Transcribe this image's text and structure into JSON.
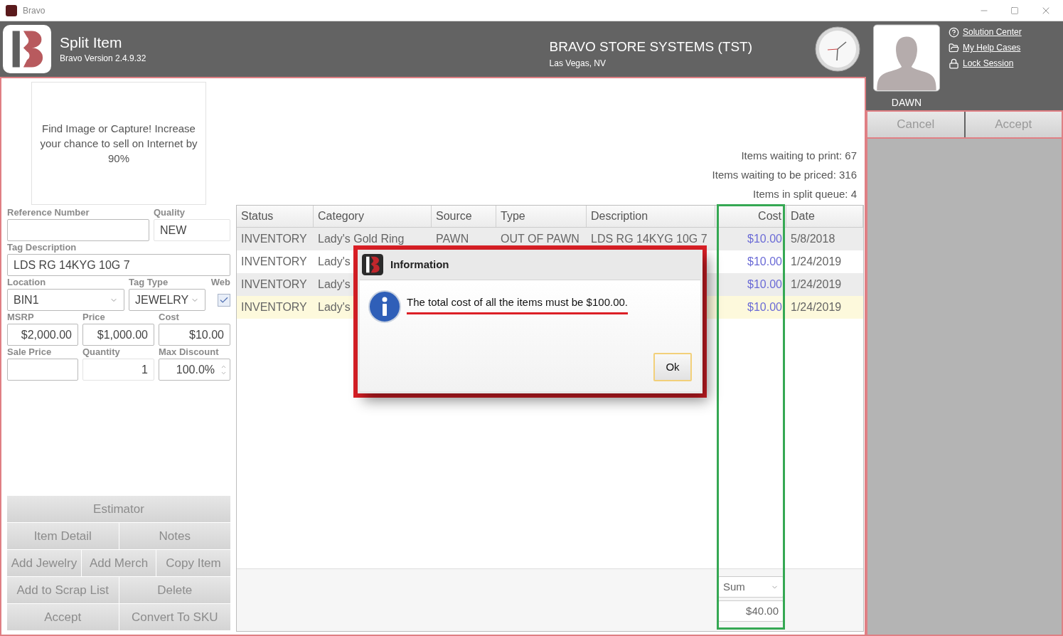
{
  "window": {
    "title": "Bravo"
  },
  "header": {
    "screen_title": "Split Item",
    "version": "Bravo Version 2.4.9.32",
    "store_name": "BRAVO STORE SYSTEMS (TST)",
    "store_location": "Las Vegas, NV",
    "user_name": "DAWN",
    "links": [
      {
        "kind": "help",
        "label": "Solution Center"
      },
      {
        "kind": "folder",
        "label": "My Help Cases"
      },
      {
        "kind": "lock",
        "label": "Lock Session"
      }
    ]
  },
  "actions": [
    "Cancel",
    "Accept"
  ],
  "image_placeholder": "Find Image or Capture! Increase your chance to sell on Internet by 90%",
  "form": [
    [
      {
        "kind": "text",
        "label": "Reference Number"
      },
      {
        "kind": "readonly",
        "label": "Quality",
        "value": "NEW"
      }
    ],
    [
      {
        "kind": "text",
        "label": "Tag Description",
        "value": "LDS RG 14KYG 10G 7"
      }
    ],
    [
      {
        "kind": "select",
        "label": "Location",
        "value": "BIN1"
      },
      {
        "kind": "select",
        "label": "Tag Type",
        "value": "JEWELRY"
      },
      {
        "kind": "checkbox",
        "label": "Web",
        "checked": true
      }
    ],
    [
      {
        "kind": "number",
        "label": "MSRP",
        "value": "$2,000.00"
      },
      {
        "kind": "number",
        "label": "Price",
        "value": "$1,000.00"
      },
      {
        "kind": "number",
        "label": "Cost",
        "value": "$10.00"
      }
    ],
    [
      {
        "kind": "number",
        "label": "Sale Price"
      },
      {
        "kind": "readonly-number",
        "label": "Quantity",
        "value": "1"
      },
      {
        "kind": "spinner",
        "label": "Max Discount",
        "value": "100.0%"
      }
    ]
  ],
  "buttons": [
    [
      "Estimator"
    ],
    [
      "Item Detail",
      "Notes"
    ],
    [
      "Add Jewelry",
      "Add Merch",
      "Copy Item"
    ],
    [
      "Add to Scrap List",
      "Delete"
    ],
    [
      "Accept",
      "Convert To SKU"
    ]
  ],
  "stats": [
    "Items waiting to print: 67",
    "Items waiting to be priced: 316",
    "Items in split queue: 4"
  ],
  "table": {
    "columns": [
      "Status",
      "Category",
      "Source",
      "Type",
      "Description",
      "Cost",
      "Date"
    ],
    "rows": [
      {
        "selected": false,
        "cells": [
          "INVENTORY",
          "Lady's Gold Ring",
          "PAWN",
          "OUT OF PAWN",
          "LDS RG 14KYG 10G 7",
          "$10.00",
          "5/8/2018"
        ]
      },
      {
        "selected": false,
        "cells": [
          "INVENTORY",
          "Lady's",
          null,
          null,
          null,
          "$10.00",
          "1/24/2019"
        ]
      },
      {
        "selected": false,
        "cells": [
          "INVENTORY",
          "Lady's",
          null,
          null,
          null,
          "$10.00",
          "1/24/2019"
        ]
      },
      {
        "selected": true,
        "cells": [
          "INVENTORY",
          "Lady's",
          null,
          null,
          null,
          "$10.00",
          "1/24/2019"
        ]
      }
    ],
    "summary": {
      "aggregate": "Sum",
      "total": "$40.00"
    }
  },
  "dialog": {
    "title": "Information",
    "message": "The total cost of all the items must be $100.00.",
    "button": "Ok"
  }
}
